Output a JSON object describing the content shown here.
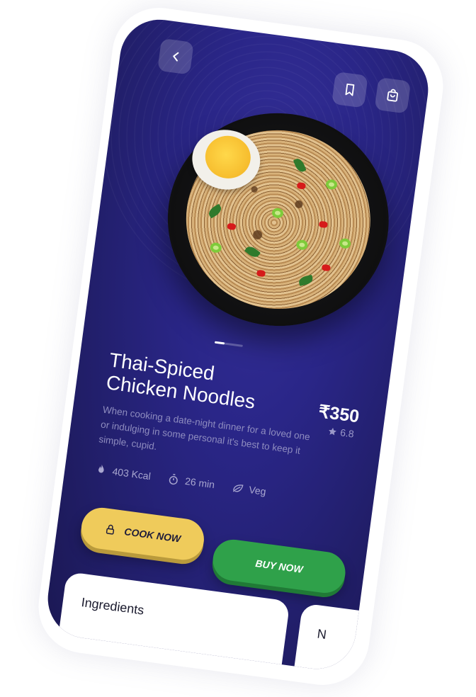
{
  "nav": {
    "back_icon": "chevron-left-icon",
    "bookmark_icon": "bookmark-icon",
    "cart_icon": "shopping-bag-icon"
  },
  "dish": {
    "title_line1": "Thai-Spiced",
    "title_line2": "Chicken Noodles",
    "price": "₹350",
    "rating": "6.8",
    "description": "When cooking a date-night dinner for a loved one or indulging in some personal it's best to keep it simple, cupid."
  },
  "stats": {
    "calories": "403 Kcal",
    "time": "26 min",
    "type": "Veg"
  },
  "carousel": {
    "total_slides": 3,
    "active_index": 1
  },
  "actions": {
    "cook_label": "COOK NOW",
    "buy_label": "BUY NOW"
  },
  "cards": {
    "ingredients_title": "Ingredients",
    "next_title": "N"
  },
  "colors": {
    "background": "#2a2688",
    "cook_button": "#efcb5b",
    "buy_button": "#2fa14a"
  }
}
